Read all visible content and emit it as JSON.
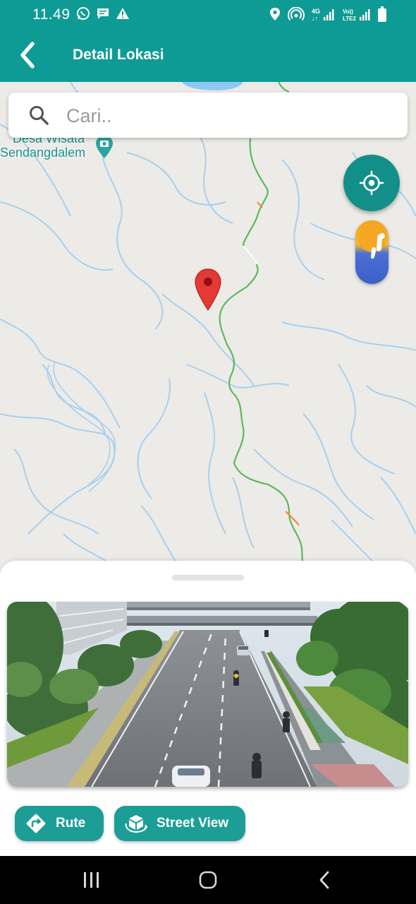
{
  "status_bar": {
    "time": "11.49",
    "left_icons": [
      "whatsapp-icon",
      "message-icon",
      "warning-icon"
    ],
    "right_icons": [
      "location-icon",
      "hotspot-icon",
      "4g-signal-icon",
      "volte-signal-icon",
      "battery-icon"
    ],
    "network_label": "4G",
    "volte_label": "Vo) LTE2"
  },
  "app_bar": {
    "title": "Detail Lokasi",
    "back_icon": "chevron-left-icon"
  },
  "search": {
    "placeholder": "Cari..",
    "value": ""
  },
  "map": {
    "poi_label_line1": "Desa Wisata",
    "poi_label_line2": "Sendangdalem",
    "marker_icon": "map-pin-icon",
    "locate_icon": "my-location-icon",
    "street_view_icon": "pegman-icon",
    "colors": {
      "background": "#ecebe8",
      "rivers": "#a9cfee",
      "road": "#5cb85c",
      "marker": "#e53935"
    }
  },
  "bottom_sheet": {
    "photo_alt": "street-view-photo",
    "buttons": {
      "route_label": "Rute",
      "street_view_label": "Street View"
    }
  },
  "nav_bar": {
    "items": [
      "recent-apps-icon",
      "home-icon",
      "back-icon"
    ]
  },
  "colors": {
    "primary": "#0f9b95",
    "button": "#1c9e97"
  }
}
